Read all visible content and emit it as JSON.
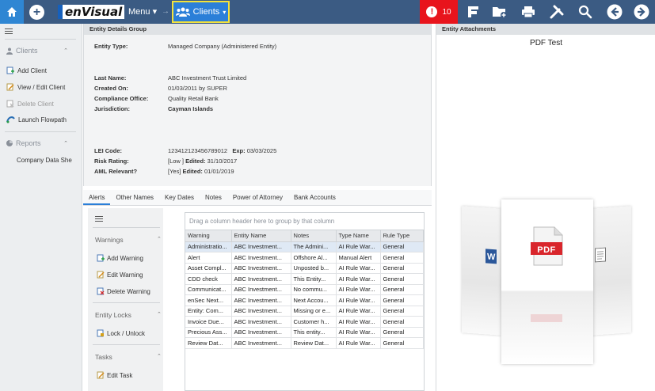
{
  "topbar": {
    "logo": "enVisual",
    "menu_label": "Menu ▾",
    "breadcrumb_sep": "→",
    "clients_label": "Clients",
    "alert_count": "10",
    "colors": {
      "bar": "#3b5b83",
      "home": "#2f86d3",
      "clients": "#2b7fd8",
      "alert": "#e8141c",
      "highlight": "#f3e23a"
    }
  },
  "sidebar": {
    "clients_section": "Clients",
    "items": [
      {
        "label": "Add Client",
        "icon": "add-client-icon"
      },
      {
        "label": "View / Edit Client",
        "icon": "edit-client-icon"
      },
      {
        "label": "Delete Client",
        "icon": "delete-client-icon",
        "disabled": true
      },
      {
        "label": "Launch Flowpath",
        "icon": "flowpath-icon"
      }
    ],
    "reports_section": "Reports",
    "reports_items": [
      {
        "label": "Company Data She"
      }
    ]
  },
  "details": {
    "header": "Entity Details Group",
    "entity_type_label": "Entity Type:",
    "entity_type": "Managed Company (Administered Entity)",
    "last_name_label": "Last Name:",
    "last_name": "ABC Investment Trust Limited",
    "created_on_label": "Created On:",
    "created_on": "01/03/2011 by SUPER",
    "compliance_label": "Compliance Office:",
    "compliance": "Quality Retail Bank",
    "jurisdiction_label": "Jurisdiction:",
    "jurisdiction": "Cayman Islands",
    "lei_label": "LEI Code:",
    "lei": "1234121234567890",
    "lei_12": "12",
    "exp_label": "Exp:",
    "exp": "03/03/2025",
    "risk_label": "Risk Rating:",
    "risk": "[Low ]",
    "risk_edited_label": "Edited:",
    "risk_edited": "31/10/2017",
    "aml_label": "AML Relevant?",
    "aml": "[Yes]",
    "aml_edited_label": "Edited:",
    "aml_edited": "01/01/2019"
  },
  "tabs": [
    "Alerts",
    "Other Names",
    "Key Dates",
    "Notes",
    "Power of Attorney",
    "Bank Accounts"
  ],
  "alerts_side": {
    "warnings": "Warnings",
    "add_warning": "Add Warning",
    "edit_warning": "Edit Warning",
    "delete_warning": "Delete Warning",
    "entity_locks": "Entity Locks",
    "lock_unlock": "Lock / Unlock",
    "tasks": "Tasks",
    "edit_task": "Edit Task"
  },
  "grid": {
    "group_placeholder": "Drag a column header here to group by that column",
    "columns": [
      "Warning",
      "Entity Name",
      "Notes",
      "Type Name",
      "Rule Type"
    ],
    "rows": [
      [
        "Administratio...",
        "ABC Investment...",
        "The Admini...",
        "AI Rule War...",
        "General"
      ],
      [
        "Alert",
        "ABC Investment...",
        "Offshore Al...",
        "Manual Alert",
        "General"
      ],
      [
        "Asset Compl...",
        "ABC Investment...",
        "Unposted b...",
        "AI Rule War...",
        "General"
      ],
      [
        "CDD check",
        "ABC Investment...",
        "This Entity...",
        "AI Rule War...",
        "General"
      ],
      [
        "Communicat...",
        "ABC Investment...",
        "No commu...",
        "AI Rule War...",
        "General"
      ],
      [
        "enSec Next...",
        "ABC Investment...",
        "Next Accou...",
        "AI Rule War...",
        "General"
      ],
      [
        "Entity: Com...",
        "ABC Investment...",
        "Missing or e...",
        "AI Rule War...",
        "General"
      ],
      [
        "Invoice Due...",
        "ABC Investment...",
        "Customer h...",
        "AI Rule War...",
        "General"
      ],
      [
        "Precious Ass...",
        "ABC Investment...",
        "This entity...",
        "AI Rule War...",
        "General"
      ],
      [
        "Review Dat...",
        "ABC Investment...",
        "Review Dat...",
        "AI Rule War...",
        "General"
      ]
    ]
  },
  "attachments": {
    "header": "Entity Attachments",
    "title": "PDF Test",
    "pdf_badge": "PDF"
  }
}
